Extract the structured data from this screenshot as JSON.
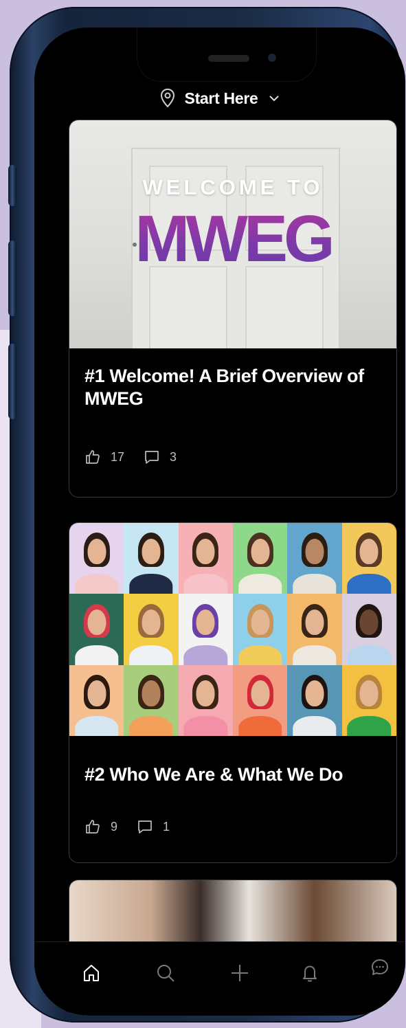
{
  "header": {
    "title": "Start Here",
    "location_icon": "location-pin-icon",
    "chevron_icon": "chevron-down-icon"
  },
  "posts": [
    {
      "hero_text": "WELCOME TO",
      "hero_logo": "MWEG",
      "title": "#1 Welcome! A Brief Overview of MWEG",
      "likes": "17",
      "comments": "3"
    },
    {
      "title": "#2 Who We Are & What We Do",
      "likes": "9",
      "comments": "1"
    }
  ],
  "tabbar": {
    "items": [
      "home-icon",
      "search-icon",
      "plus-icon",
      "bell-icon",
      "chat-icon"
    ],
    "active": "home-icon"
  },
  "colors": {
    "accent": "#8a3fa2",
    "background": "#000000",
    "stat_text": "#bdbdbd"
  }
}
